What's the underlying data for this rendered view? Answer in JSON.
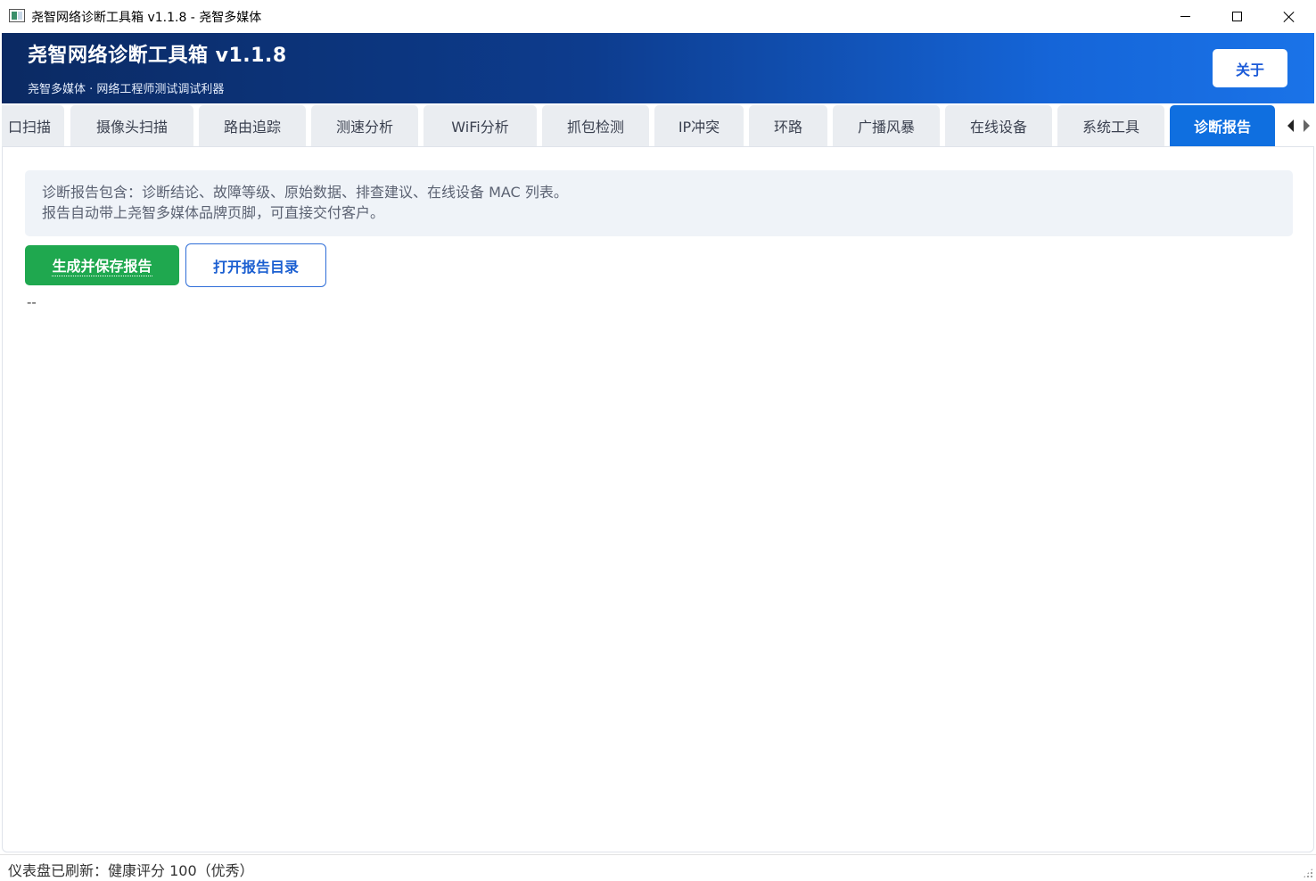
{
  "window": {
    "title": "尧智网络诊断工具箱 v1.1.8 - 尧智多媒体"
  },
  "header": {
    "title": "尧智网络诊断工具箱  v1.1.8",
    "subtitle": "尧智多媒体 · 网络工程师测试调试利器",
    "about_label": "关于"
  },
  "tabs": [
    {
      "label": "口扫描",
      "active": false
    },
    {
      "label": "摄像头扫描",
      "active": false
    },
    {
      "label": "路由追踪",
      "active": false
    },
    {
      "label": "测速分析",
      "active": false
    },
    {
      "label": "WiFi分析",
      "active": false
    },
    {
      "label": "抓包检测",
      "active": false
    },
    {
      "label": "IP冲突",
      "active": false
    },
    {
      "label": "环路",
      "active": false
    },
    {
      "label": "广播风暴",
      "active": false
    },
    {
      "label": "在线设备",
      "active": false
    },
    {
      "label": "系统工具",
      "active": false
    },
    {
      "label": "诊断报告",
      "active": true
    }
  ],
  "report": {
    "info_line1": "诊断报告包含：诊断结论、故障等级、原始数据、排查建议、在线设备 MAC 列表。",
    "info_line2": "报告自动带上尧智多媒体品牌页脚，可直接交付客户。",
    "generate_label": "生成并保存报告",
    "open_dir_label": "打开报告目录",
    "output": "--"
  },
  "status": {
    "text": "仪表盘已刷新：健康评分 100（优秀）"
  },
  "colors": {
    "accent": "#0f6fe0",
    "success": "#1fa84f",
    "header_dark": "#0b2a63"
  }
}
